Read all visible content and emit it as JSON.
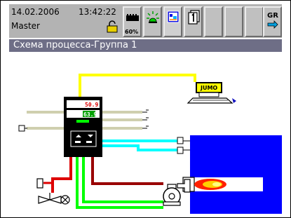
{
  "status": {
    "date": "14.02.2006",
    "time": "13:42:22",
    "user": "Master",
    "memory_label": "60%"
  },
  "toolbar": {
    "buttons": [
      {
        "icon": "memory-card-icon"
      },
      {
        "icon": "alarm-icon"
      },
      {
        "icon": "process-screen-icon",
        "active": true
      },
      {
        "icon": "group-1-icon",
        "label": "1"
      },
      {
        "icon": "empty-slot"
      },
      {
        "icon": "empty-slot"
      },
      {
        "icon": "empty-slot"
      },
      {
        "icon": "group-report-icon",
        "label": "GR"
      }
    ]
  },
  "window": {
    "title": "Схема процесса-Группа 1"
  },
  "diagram": {
    "controller_display_top": "50.9",
    "controller_display_bottom": "63.9",
    "brand_label": "JUMO",
    "colors": {
      "yellow": "#ffff00",
      "cyan": "#00ffff",
      "red": "#cc0000",
      "darkred": "#990000",
      "green": "#00ff00",
      "olive": "#cfcfae",
      "blue": "#0000ff"
    }
  }
}
